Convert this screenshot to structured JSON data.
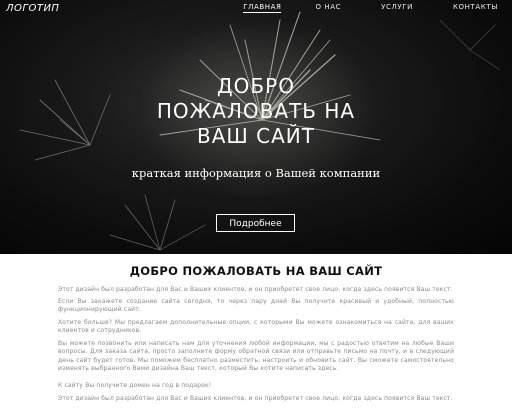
{
  "header": {
    "logo": "ЛОГОТИП",
    "nav": [
      "ГЛАВНАЯ",
      "О НАС",
      "УСЛУГИ",
      "КОНТАКТЫ"
    ]
  },
  "hero": {
    "title": "ДОБРО ПОЖАЛОВАТЬ НА ВАШ САЙТ",
    "subtitle": "краткая информация о Вашей компании",
    "button": "Подробнее"
  },
  "content": {
    "title": "ДОБРО ПОЖАЛОВАТЬ НА ВАШ САЙТ",
    "paragraphs": [
      "Этот дизайн был разработан для Вас и Ваших клиентов, и он приобретет свое лицо, когда здесь появится Ваш текст.",
      "Если Вы закажете создание сайта сегодня, то через пару дней Вы получите красивый и удобный, полностью функционирующий сайт.",
      "Хотите больше? Мы предлагаем дополнительные опции, с которыми Вы можете ознакомиться на сайте, для ваших клиентов и сотрудников.",
      "Вы можете позвонить или написать нам для уточнения любой информации, мы с радостью ответим на любые Ваши вопросы. Для заказа сайта, просто заполните форму обратной связи или отправьте письмо на почту, и в следующий день сайт будет готов. Мы поможем бесплатно разместить, настроить и обновить сайт. Вы сможете самостоятельно изменять выбранного Вами дизайна Ваш текст, который Вы хотите написать здесь.",
      "К сайту Вы получите домен на год в подарок!",
      "Этот дизайн был разработан для Вас и Ваших клиентов, и он приобретет свое лицо, когда здесь появится Ваш текст."
    ]
  },
  "colors": {
    "hero_bg": "#111111",
    "text_light": "#ffffff",
    "body_text": "#8a8a8a",
    "heading": "#111111"
  }
}
